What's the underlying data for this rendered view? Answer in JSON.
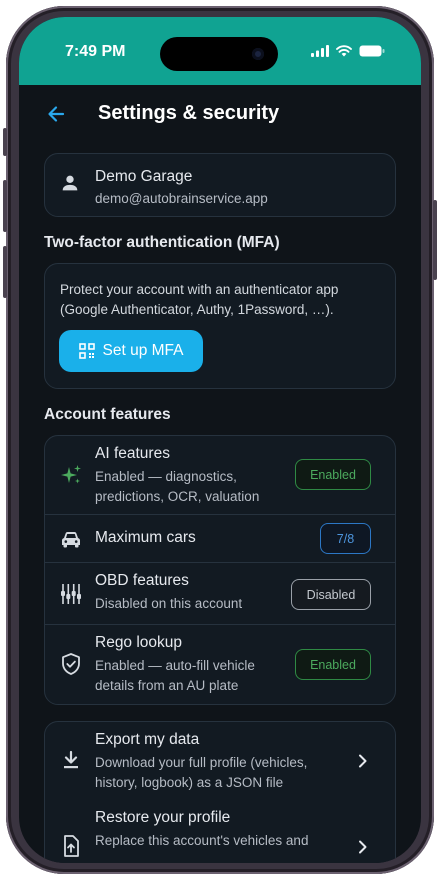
{
  "status": {
    "time": "7:49 PM"
  },
  "header": {
    "title": "Settings & security"
  },
  "profile": {
    "name": "Demo Garage",
    "email": "demo@autobrainservice.app"
  },
  "mfa": {
    "section_title": "Two-factor authentication (MFA)",
    "description": "Protect your account with an authenticator app (Google Authenticator, Authy, 1Password, …).",
    "button_label": "Set up MFA"
  },
  "features": {
    "section_title": "Account features",
    "items": [
      {
        "title": "AI features",
        "subtitle": "Enabled — diagnostics, predictions, OCR, valuation",
        "badge": "Enabled",
        "icon": "sparkle-icon"
      },
      {
        "title": "Maximum cars",
        "subtitle": "",
        "badge": "7/8",
        "icon": "car-icon"
      },
      {
        "title": "OBD features",
        "subtitle": "Disabled on this account",
        "badge": "Disabled",
        "icon": "obd-connector-icon"
      },
      {
        "title": "Rego lookup",
        "subtitle": "Enabled — auto-fill vehicle details from an AU plate",
        "badge": "Enabled",
        "icon": "shield-check-icon"
      }
    ]
  },
  "data_actions": {
    "items": [
      {
        "title": "Export my data",
        "subtitle": "Download your full profile (vehicles, history, logbook) as a JSON file",
        "icon": "download-icon"
      },
      {
        "title": "Restore your profile",
        "subtitle": "Replace this account's vehicles and",
        "icon": "upload-file-icon"
      }
    ]
  },
  "colors": {
    "status_bar": "#10a392",
    "background": "#0f1419",
    "accent": "#1ab0ea",
    "enabled": "#4caa5e",
    "count_badge": "#4d95dd"
  }
}
